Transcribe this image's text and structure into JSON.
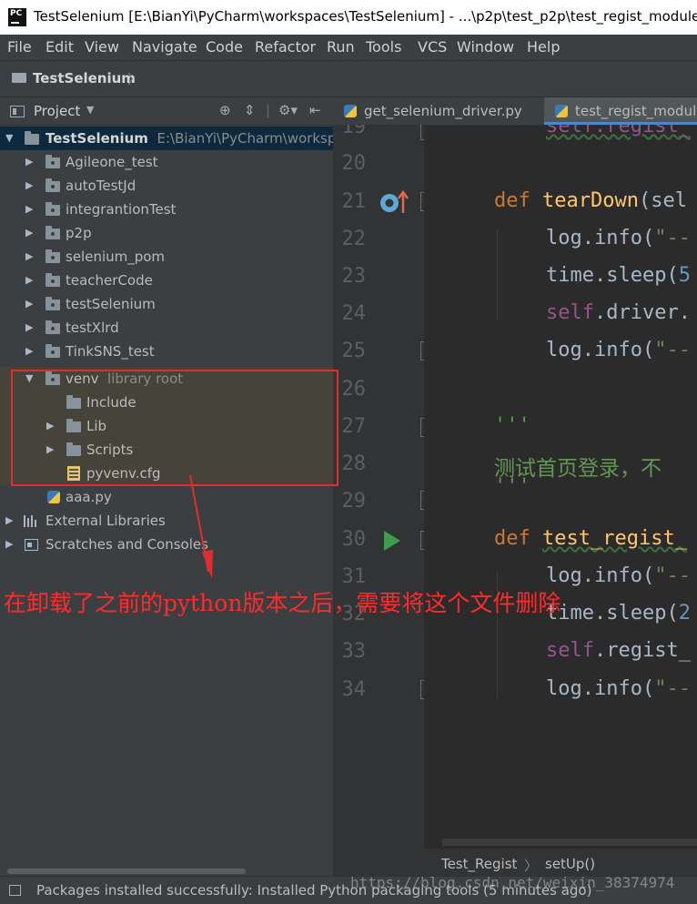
{
  "window": {
    "title": "TestSelenium [E:\\BianYi\\PyCharm\\workspaces\\TestSelenium] - ...\\p2p\\test_p2p\\test_regist_module.py",
    "app_icon_text": "PC"
  },
  "menu": [
    "File",
    "Edit",
    "View",
    "Navigate",
    "Code",
    "Refactor",
    "Run",
    "Tools",
    "VCS",
    "Window",
    "Help"
  ],
  "navbar": {
    "project": "TestSelenium"
  },
  "project_panel": {
    "title": "Project",
    "root": {
      "name": "TestSelenium",
      "path": "E:\\BianYi\\PyCharm\\workspac"
    },
    "folders": [
      "Agileone_test",
      "autoTestJd",
      "integrantionTest",
      "p2p",
      "selenium_pom",
      "teacherCode",
      "testSelenium",
      "testXlrd",
      "TinkSNS_test"
    ],
    "venv": {
      "name": "venv",
      "tag": "library root",
      "children": [
        "Include",
        "Lib",
        "Scripts",
        "pyvenv.cfg"
      ]
    },
    "file": "aaa.py",
    "external": "External Libraries",
    "scratches": "Scratches and Consoles"
  },
  "editor": {
    "tabs": [
      "get_selenium_driver.py",
      "test_regist_module"
    ],
    "line_numbers": [
      "19",
      "20",
      "21",
      "22",
      "23",
      "24",
      "25",
      "26",
      "27",
      "28",
      "29",
      "30",
      "31",
      "32",
      "33",
      "34"
    ],
    "code": {
      "l19": "self.regist_",
      "l21_kw": "def",
      "l21_fn": "tearDown",
      "l21_rest": "(sel",
      "l22_a": "log.info(",
      "l22_b": "\"--",
      "l23_a": "time.sleep(",
      "l23_b": "5",
      "l24_a": "self",
      "l24_b": ".driver.",
      "l25_a": "log.info(",
      "l25_b": "\"--",
      "l27": "'''",
      "l28": "测试首页登录，不",
      "l29": "'''",
      "l30_kw": "def",
      "l30_fn": "test_regist_",
      "l31_a": "log.info(",
      "l31_b": "\"--",
      "l32_a": "time.sleep(",
      "l32_b": "2",
      "l33_a": "self",
      "l33_b": ".regist_",
      "l34_a": "log.info(",
      "l34_b": "\"--"
    },
    "breadcrumbs": [
      "Test_Regist",
      "setUp()"
    ]
  },
  "status": {
    "message": "Packages installed successfully: Installed Python packaging tools (5 minutes ago)"
  },
  "watermark": "https://blog.csdn.net/weixin_38374974",
  "annotation": {
    "text": "在卸载了之前的python版本之后，需要将这个文件删除",
    "color": "#ff2b2b"
  },
  "colors": {
    "selection": "#0d293e",
    "library_highlight": "#45433a",
    "annotation_box": "#e32d2d",
    "keyword": "#cc7832",
    "function": "#ffc66d"
  }
}
